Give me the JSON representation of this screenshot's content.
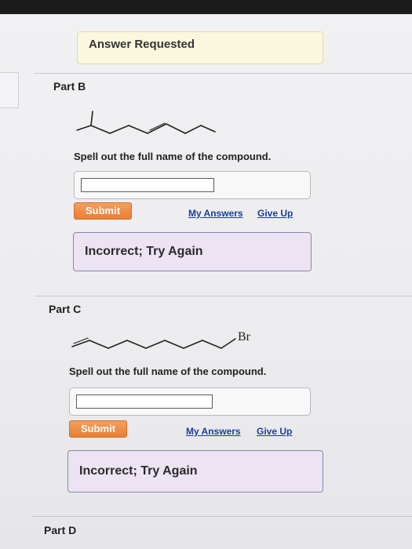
{
  "header": {
    "status": "Answer Requested"
  },
  "question_text": "Spell out the full name of the compound.",
  "parts": [
    {
      "id": "part-b",
      "title": "Part B",
      "input_value": "",
      "submit_label": "Submit",
      "my_answers_label": "My Answers",
      "give_up_label": "Give Up",
      "feedback": "Incorrect; Try Again"
    },
    {
      "id": "part-c",
      "title": "Part C",
      "substituent_label": "Br",
      "input_value": "",
      "submit_label": "Submit",
      "my_answers_label": "My Answers",
      "give_up_label": "Give Up",
      "feedback": "Incorrect; Try Again"
    },
    {
      "id": "part-d",
      "title": "Part D"
    }
  ],
  "colors": {
    "submit": "#e67f32",
    "link": "#1a3d9c",
    "feedback_bg": "#ece3f3",
    "answer_bg": "#fbf7df"
  }
}
